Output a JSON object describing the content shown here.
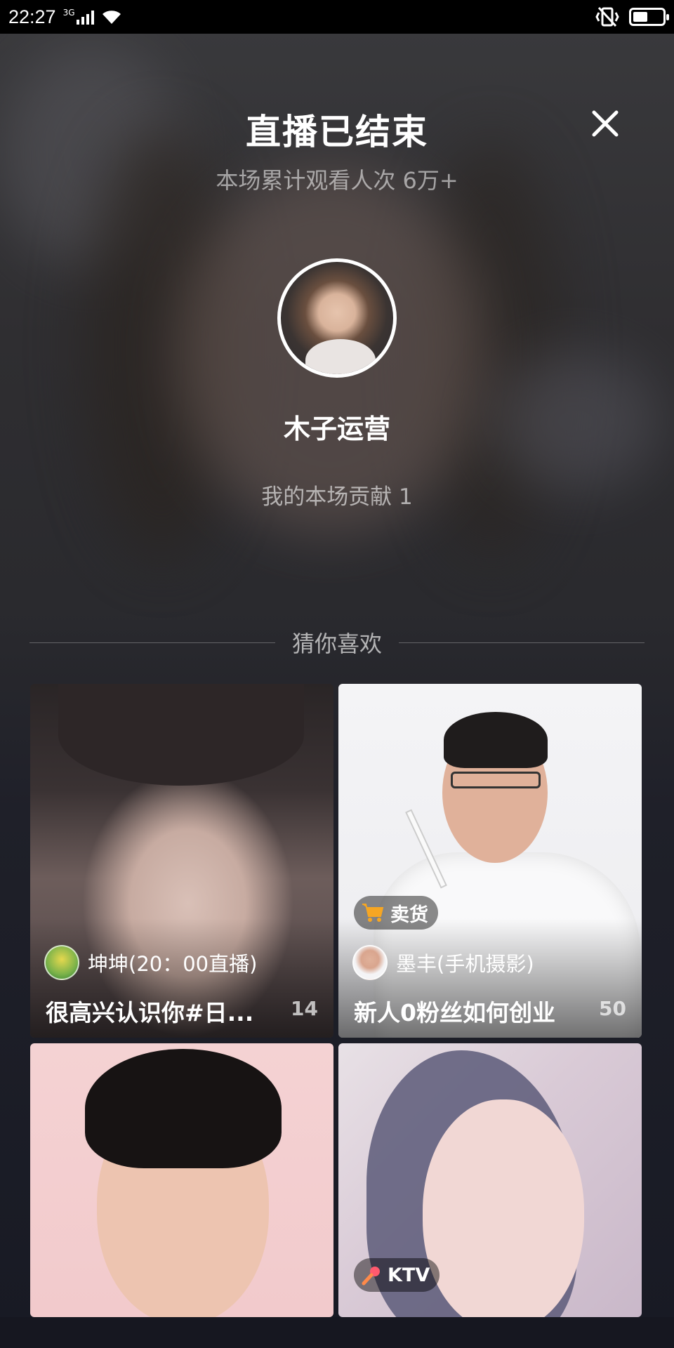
{
  "status_bar": {
    "time": "22:27",
    "network": "3G",
    "battery_level": 0.5
  },
  "header": {
    "title": "直播已结束",
    "viewers": "本场累计观看人次 6万+"
  },
  "host": {
    "name": "木子运营",
    "contribution": "我的本场贡献 1"
  },
  "recommend": {
    "section_label": "猜你喜欢",
    "cards": [
      {
        "user": "坤坤(20：00直播)",
        "title": "很高兴认识你#日...",
        "count": "14",
        "tag": ""
      },
      {
        "user": "墨丰(手机摄影)",
        "title": "新人0粉丝如何创业",
        "count": "50",
        "tag": "卖货"
      },
      {
        "user": "",
        "title": "",
        "count": "",
        "tag": ""
      },
      {
        "user": "",
        "title": "",
        "count": "",
        "tag": "KTV"
      }
    ]
  },
  "icons": {
    "close": "close-icon",
    "cart": "cart-icon",
    "mic": "microphone-icon"
  },
  "colors": {
    "background": "#161720",
    "text": "#ffffff",
    "cart_tag": "#f6a623",
    "mic_tag": "#ff5a6e"
  }
}
